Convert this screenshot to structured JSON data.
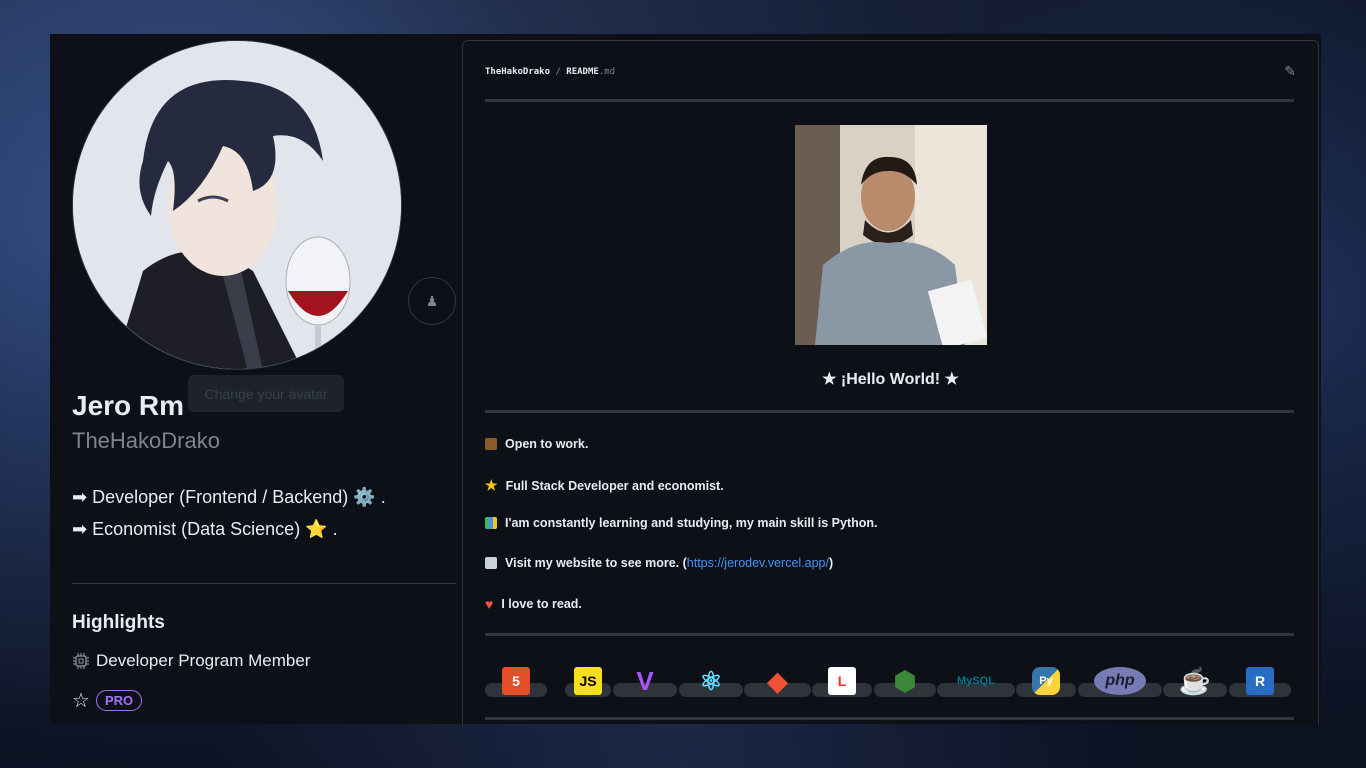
{
  "profile": {
    "name": "Jero Rm",
    "login": "TheHakoDrako",
    "tooltip": "Change your avatar",
    "bio": [
      {
        "arrow": "➡",
        "text": "Developer (Frontend / Backend)",
        "emoji": "⚙️",
        "suffix": "."
      },
      {
        "arrow": "➡",
        "text": "Economist (Data Science)",
        "emoji": "⭐",
        "suffix": "."
      }
    ],
    "highlights": {
      "title": "Highlights",
      "program": "Developer Program Member",
      "pro": "PRO"
    }
  },
  "readme": {
    "owner": "TheHakoDrako",
    "separator": "/",
    "file": "README",
    "ext": ".md",
    "hello": "★ ¡Hello World! ★",
    "lines": [
      {
        "icon": "briefcase-icon",
        "color": "#8b5a2b",
        "text": "Open to work."
      },
      {
        "icon": "star-icon",
        "color": "#f5c518",
        "text": "Full Stack Developer and economist."
      },
      {
        "icon": "books-icon",
        "color": "#3fb950",
        "text": "I'am constantly learning and studying, my main skill is Python."
      },
      {
        "icon": "page-icon",
        "color": "#c9d1d9",
        "text": "Visit my website to see more. (",
        "link": "https://jerodev.vercel.app/",
        "after": ")"
      },
      {
        "icon": "heart-icon",
        "color": "#f85149",
        "text": "I love to read."
      }
    ],
    "badges": [
      {
        "name": "html5-icon",
        "label": "5",
        "color": "#e34f26"
      },
      {
        "name": "javascript-icon",
        "label": "JS",
        "color": "#f7df1e"
      },
      {
        "name": "vite-icon",
        "label": "V",
        "color": "#a855f7"
      },
      {
        "name": "react-icon",
        "label": "⚛",
        "color": "#61dafb"
      },
      {
        "name": "git-icon",
        "label": "◆",
        "color": "#f05033"
      },
      {
        "name": "laravel-icon",
        "label": "L",
        "color": "#ff2d20"
      },
      {
        "name": "nodejs-icon",
        "label": "⬢",
        "color": "#3c873a"
      },
      {
        "name": "mysql-icon",
        "label": "MySQL",
        "color": "#00758f"
      },
      {
        "name": "python-icon",
        "label": "Py",
        "color": "#3776ab"
      },
      {
        "name": "php-icon",
        "label": "php",
        "color": "#777bb3"
      },
      {
        "name": "java-icon",
        "label": "☕",
        "color": "#e76f00"
      },
      {
        "name": "r-icon",
        "label": "R",
        "color": "#276dc3"
      }
    ]
  }
}
